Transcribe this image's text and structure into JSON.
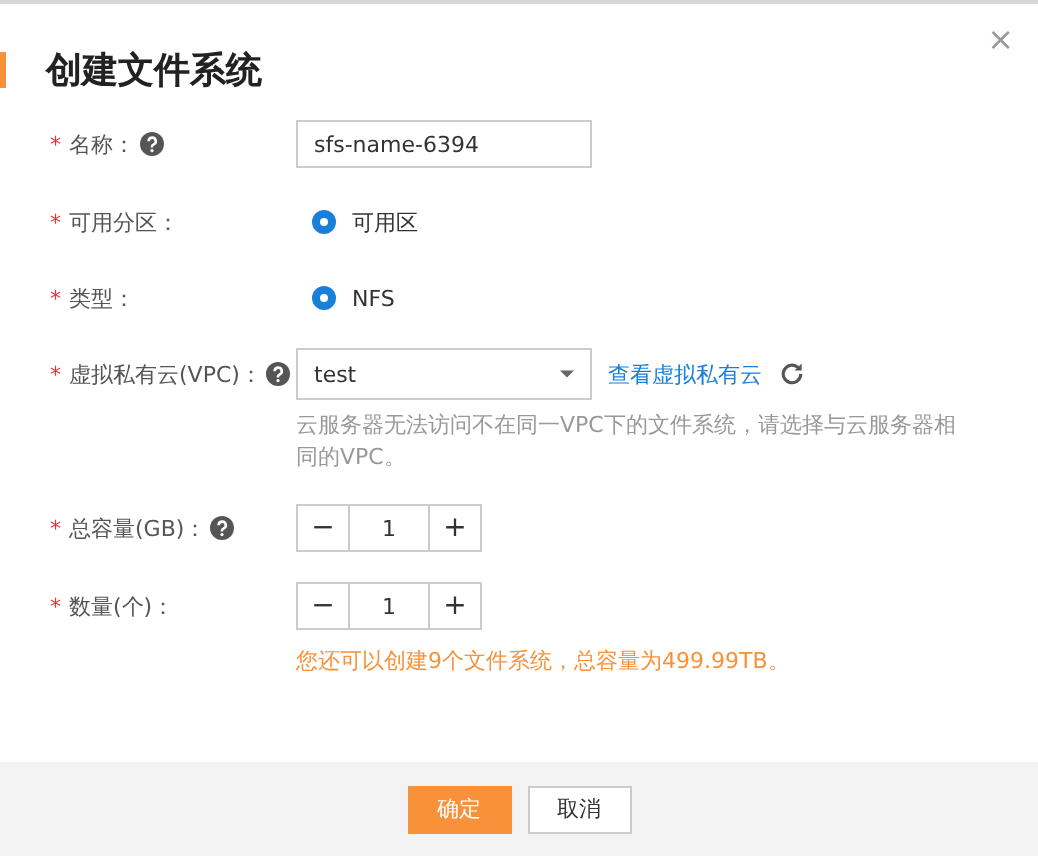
{
  "dialog": {
    "title": "创建文件系统",
    "close": "×"
  },
  "fields": [
    {
      "kind": "text",
      "label": "名称：",
      "required": "*",
      "help": true,
      "value": "sfs-name-6394"
    },
    {
      "kind": "radio",
      "label": "可用分区：",
      "required": "*",
      "help": false,
      "options": [
        {
          "label": "可用区",
          "selected": true
        }
      ]
    },
    {
      "kind": "radio",
      "label": "类型：",
      "required": "*",
      "help": false,
      "options": [
        {
          "label": "NFS",
          "selected": true
        }
      ]
    },
    {
      "kind": "select",
      "label": "虚拟私有云(VPC)：",
      "required": "*",
      "help": true,
      "value": "test",
      "link": "查看虚拟私有云",
      "hint": "云服务器无法访问不在同一VPC下的文件系统，请选择与云服务器相同的VPC。"
    },
    {
      "kind": "stepper",
      "label": "总容量(GB)：",
      "required": "*",
      "help": true,
      "value": "1",
      "minus": "−",
      "plus": "+"
    },
    {
      "kind": "stepper",
      "label": "数量(个)：",
      "required": "*",
      "help": false,
      "value": "1",
      "minus": "−",
      "plus": "+",
      "notice": "您还可以创建9个文件系统，总容量为499.99TB。"
    }
  ],
  "buttons": [
    {
      "label": "确定",
      "primary": true
    },
    {
      "label": "取消",
      "primary": false
    }
  ]
}
